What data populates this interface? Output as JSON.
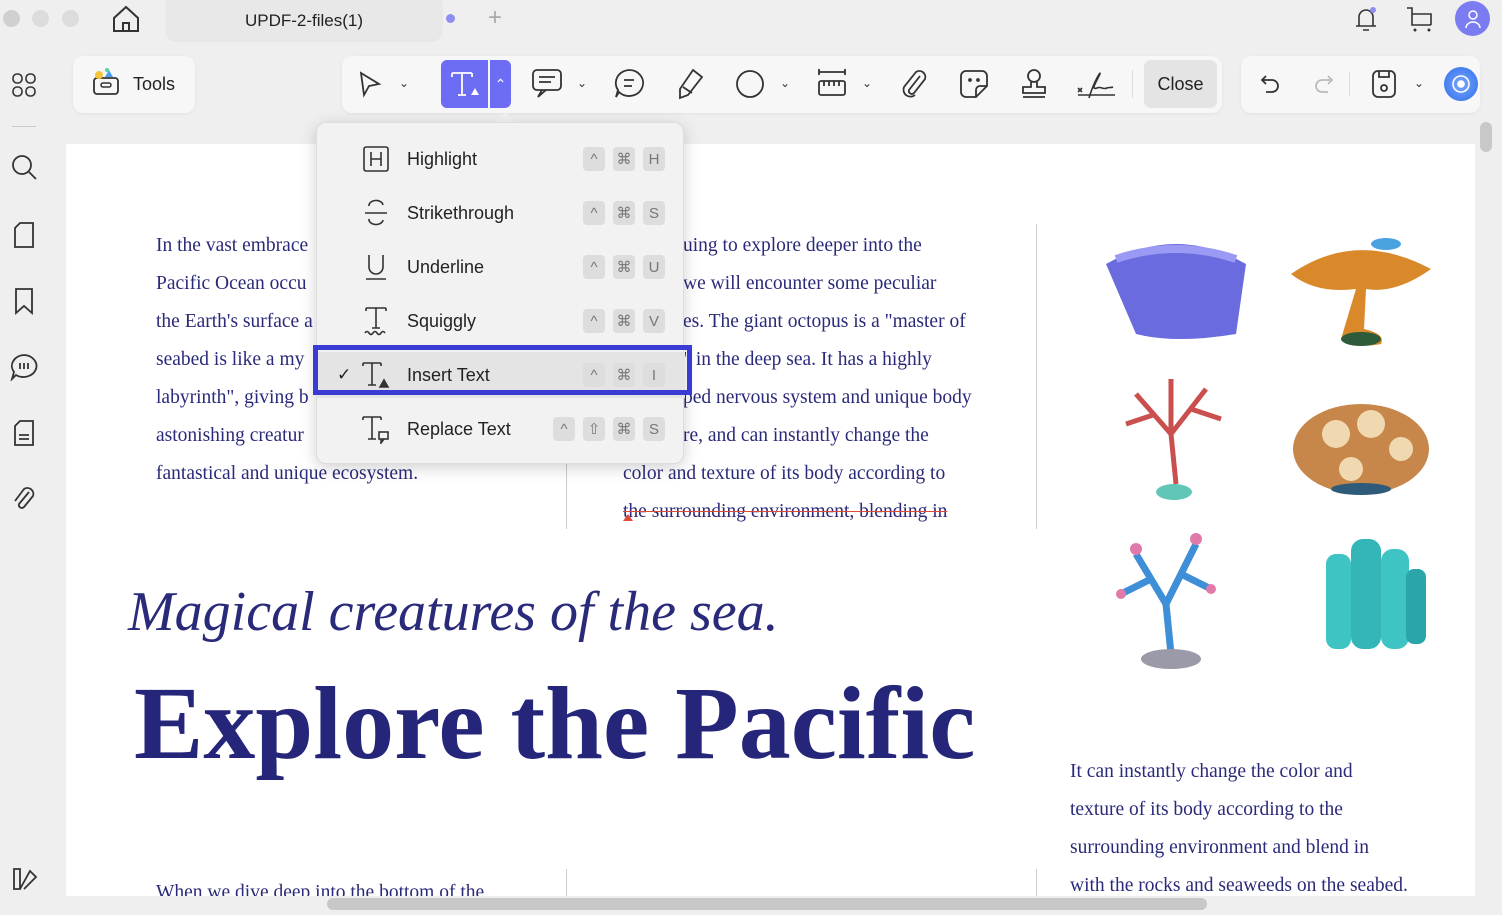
{
  "window": {
    "tab_title": "UPDF-2-files(1)",
    "new_tab": "+"
  },
  "toolbar": {
    "tools_label": "Tools",
    "close_label": "Close",
    "accent": "#6c6cf5"
  },
  "menu": {
    "items": [
      {
        "label": "Highlight",
        "icon": "highlight-icon",
        "keys": [
          "^",
          "⌘",
          "H"
        ],
        "checked": false
      },
      {
        "label": "Strikethrough",
        "icon": "strikethrough-icon",
        "keys": [
          "^",
          "⌘",
          "S"
        ],
        "checked": false
      },
      {
        "label": "Underline",
        "icon": "underline-icon",
        "keys": [
          "^",
          "⌘",
          "U"
        ],
        "checked": false
      },
      {
        "label": "Squiggly",
        "icon": "squiggly-icon",
        "keys": [
          "^",
          "⌘",
          "V"
        ],
        "checked": false
      },
      {
        "label": "Insert Text",
        "icon": "insert-text-icon",
        "keys": [
          "^",
          "⌘",
          "I"
        ],
        "checked": true
      },
      {
        "label": "Replace Text",
        "icon": "replace-text-icon",
        "keys": [
          "^",
          "⇧",
          "⌘",
          "S"
        ],
        "checked": false
      }
    ],
    "check": "✓"
  },
  "document": {
    "col1": [
      "In the vast embrace",
      "Pacific Ocean occu",
      "the Earth's surface a",
      "seabed is like a my",
      "labyrinth\", giving b",
      "astonishing creatur",
      "fantastical and unique ecosystem."
    ],
    "col2": [
      "uing to explore deeper into the",
      "we will encounter some peculiar",
      "es. The giant octopus is a \"master of",
      "\" in the deep sea. It has a highly",
      "ped nervous system and unique body",
      "re, and can instantly change the",
      "color and texture of its body according to",
      "the surrounding environment, blending in"
    ],
    "subtitle": "Magical creatures of the sea.",
    "title": "Explore the Pacific",
    "col3": [
      "It can instantly change the color and",
      "texture of its body according to the",
      "surrounding environment and blend in",
      "with the rocks and seaweeds on the seabed."
    ],
    "bottom_col1": "When we dive deep into the bottom of the"
  }
}
